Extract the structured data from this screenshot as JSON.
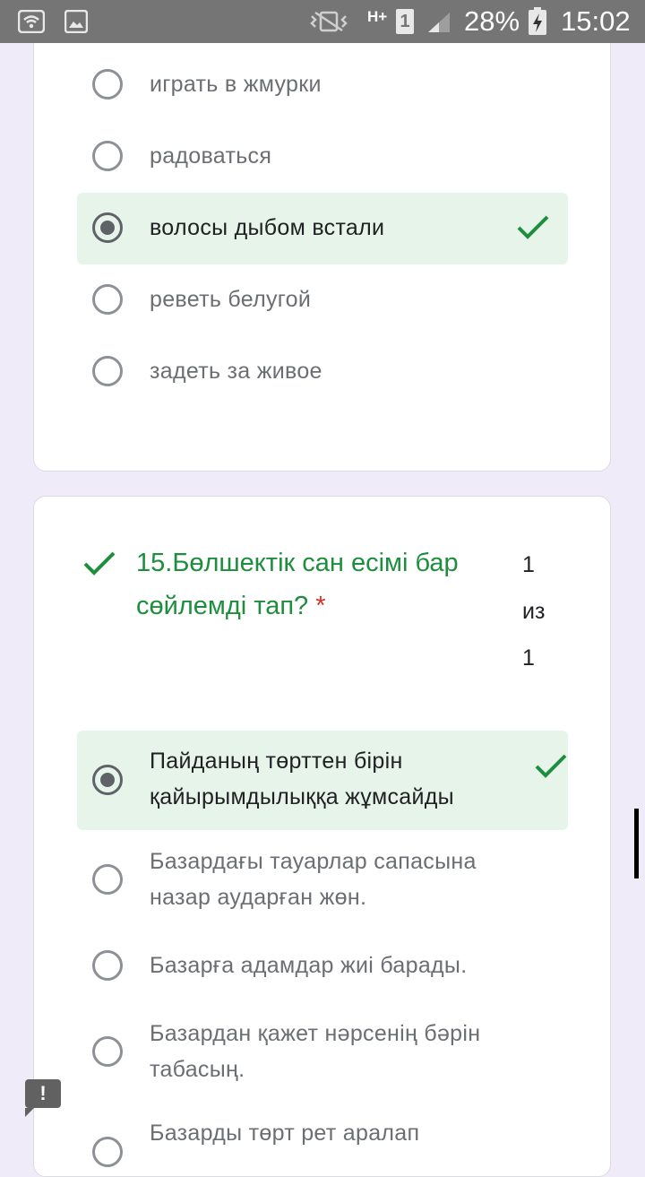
{
  "status_bar": {
    "battery": "28%",
    "time": "15:02",
    "network": "H+",
    "sim": "1",
    "icons": [
      "wifi-icon",
      "gallery-icon",
      "vibrate-icon",
      "signal-icon",
      "battery-charging-icon"
    ]
  },
  "question_prev": {
    "options": [
      {
        "label": "играть в жмурки",
        "selected": false,
        "correct": false
      },
      {
        "label": "радоваться",
        "selected": false,
        "correct": false
      },
      {
        "label": "волосы дыбом встали",
        "selected": true,
        "correct": true
      },
      {
        "label": "реветь белугой",
        "selected": false,
        "correct": false
      },
      {
        "label": "задеть за живое",
        "selected": false,
        "correct": false
      }
    ]
  },
  "question_15": {
    "title": "15.Бөлшектік сан есімі бар сөйлемді тап?",
    "required_mark": "*",
    "score": {
      "got": "1",
      "of": "из",
      "total": "1"
    },
    "options": [
      {
        "label": "Пайданың төрттен бірін қайырымдылыққа жұмсайды",
        "selected": true,
        "correct": true
      },
      {
        "label": "Базардағы тауарлар сапасына назар аударған жөн.",
        "selected": false,
        "correct": false
      },
      {
        "label": "Базарға адамдар жиі барады.",
        "selected": false,
        "correct": false
      },
      {
        "label": "Базардан қажет нәрсенің бәрін табасың.",
        "selected": false,
        "correct": false
      },
      {
        "label": "Базарды төрт рет аралап",
        "selected": false,
        "correct": false
      }
    ]
  },
  "feedback_button": {
    "label": "!"
  },
  "colors": {
    "correct_green": "#1e8e3e",
    "correct_bg": "#e6f4ea",
    "required_red": "#d93025"
  }
}
